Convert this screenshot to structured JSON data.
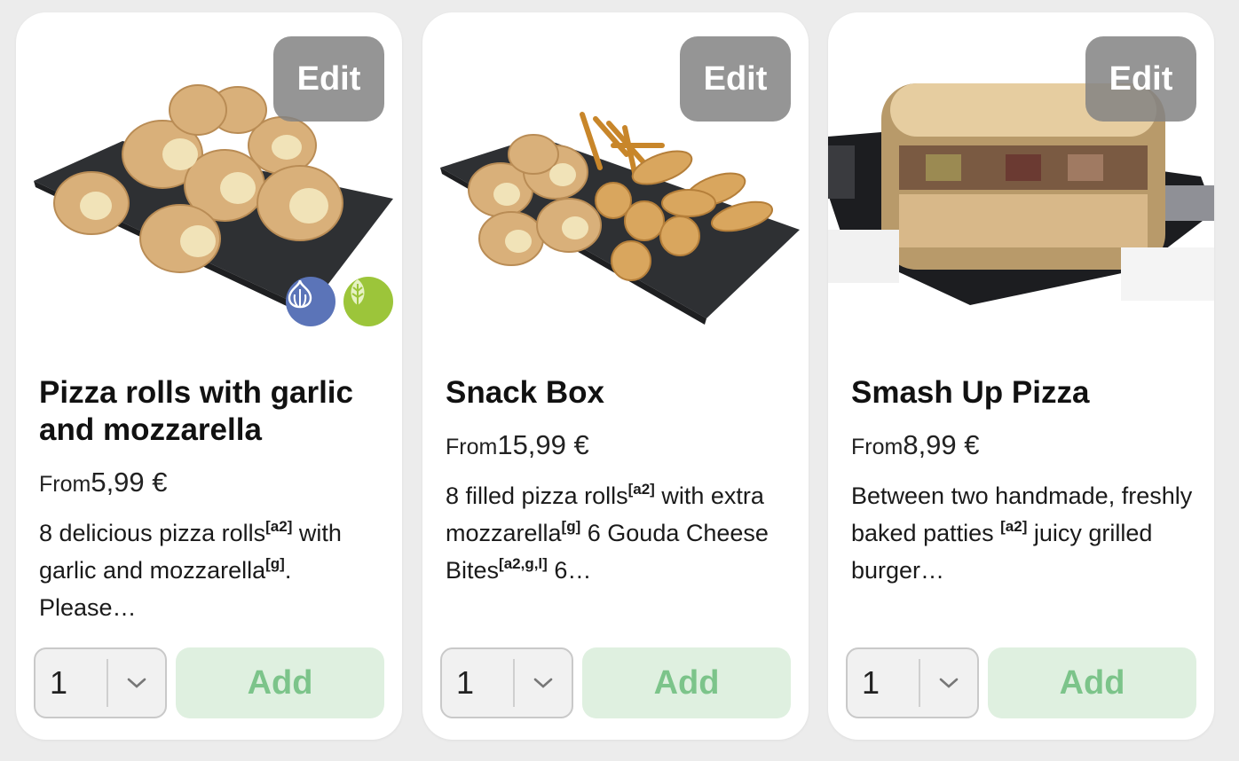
{
  "products": [
    {
      "edit_label": "Edit",
      "title": "Pizza rolls with garlic and mozzarella",
      "price_prefix": "From",
      "price": "5,99 €",
      "desc": {
        "p1": "8 delicious pizza rolls",
        "s1": "[a2]",
        "p2": " with garlic and mozzarella",
        "s2": "[g]",
        "p3": ". Please…"
      },
      "badges": [
        "garlic-icon",
        "vegetarian-leaf-icon"
      ],
      "quantity": "1",
      "add_label": "Add"
    },
    {
      "edit_label": "Edit",
      "title": "Snack Box",
      "price_prefix": "From",
      "price": "15,99 €",
      "desc": {
        "p1": "8 filled pizza rolls",
        "s1": "[a2]",
        "p2": " with extra mozzarella",
        "s2": "[g]",
        "p3": " 6 Gouda Cheese Bites",
        "s3": "[a2,g,l]",
        "p4": " 6…"
      },
      "quantity": "1",
      "add_label": "Add"
    },
    {
      "edit_label": "Edit",
      "title": "Smash Up Pizza",
      "price_prefix": "From",
      "price": "8,99 €",
      "desc": {
        "p1": "Between two handmade, freshly baked patties ",
        "s1": "[a2]",
        "p2": " juicy grilled burger…"
      },
      "quantity": "1",
      "add_label": "Add"
    }
  ],
  "colors": {
    "add_bg": "#dff0e0",
    "add_text": "#7cc48a",
    "edit_bg": "#8a8a8a",
    "garlic_badge": "#5b74b8",
    "veg_badge": "#9cc53a"
  }
}
